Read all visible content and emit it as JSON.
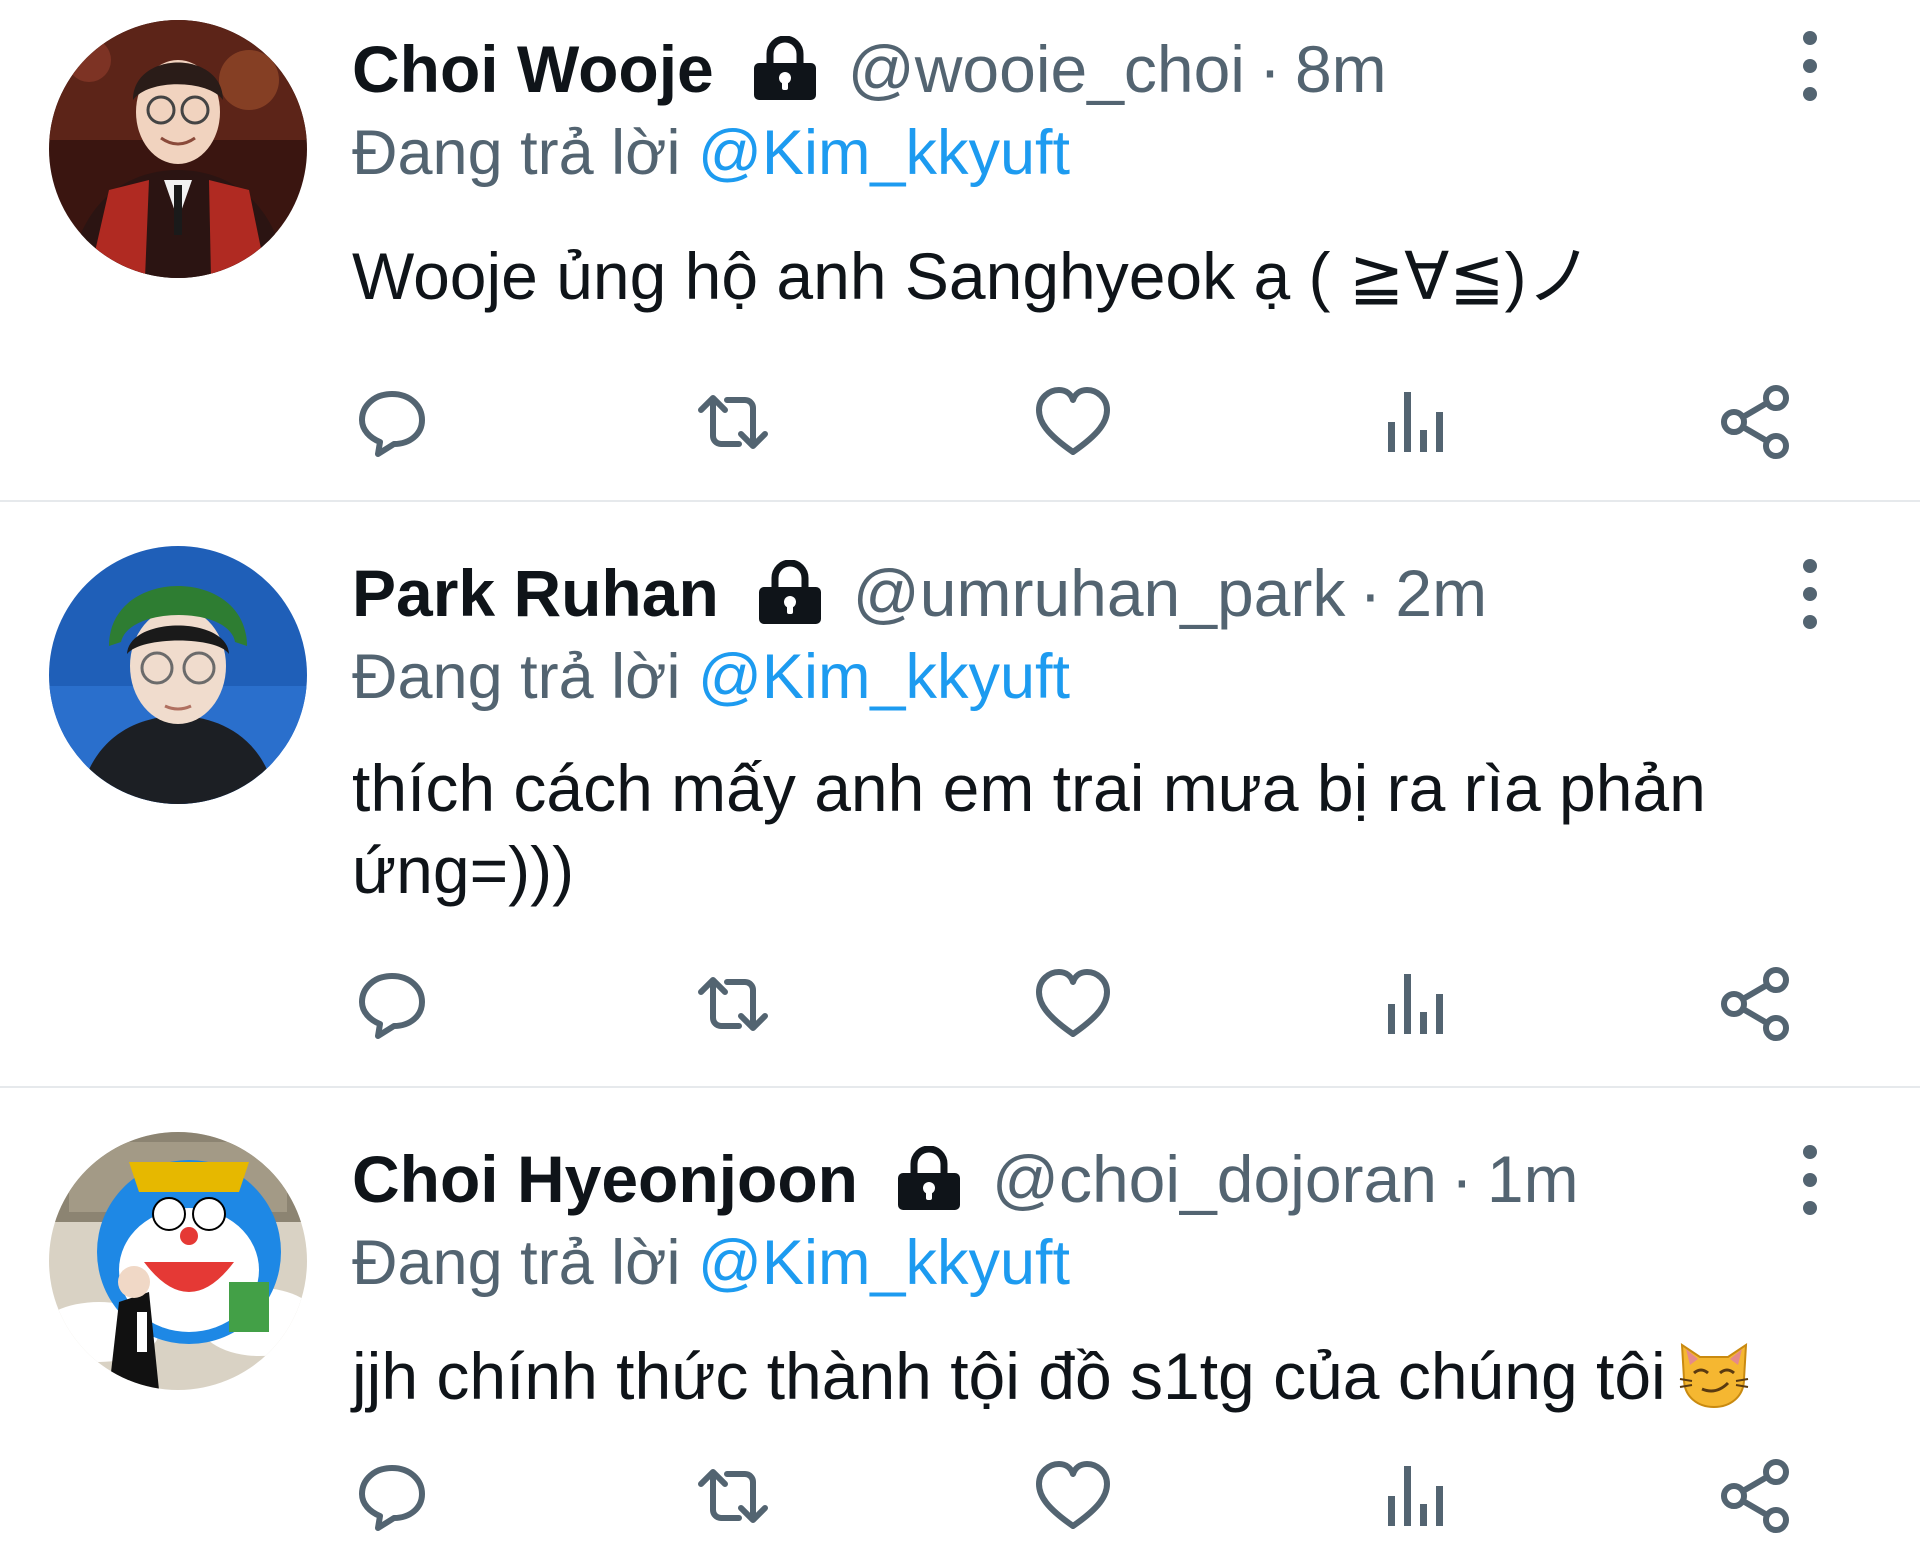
{
  "colors": {
    "text": "#0f1419",
    "secondary": "#536471",
    "accent": "#1d9bf0",
    "divider": "#e6e9ec"
  },
  "tweets": [
    {
      "name": "Choi Wooje",
      "handle": "@wooie_choi",
      "separator": "·",
      "time": "8m",
      "reply_prefix": "Đang trả lời",
      "reply_to": "@Kim_kkyuft",
      "text": "Wooje ủng hộ anh Sanghyeok ạ ( ≧∀≦)ノ",
      "protected_icon": "lock-icon"
    },
    {
      "name": "Park Ruhan",
      "handle": "@umruhan_park",
      "separator": "·",
      "time": "2m",
      "reply_prefix": "Đang trả lời",
      "reply_to": "@Kim_kkyuft",
      "text": "thích cách mấy anh em trai mưa bị ra rìa phản ứng=)))",
      "protected_icon": "lock-icon"
    },
    {
      "name": "Choi Hyeonjoon",
      "handle": "@choi_dojoran",
      "separator": "·",
      "time": "1m",
      "reply_prefix": "Đang trả lời",
      "reply_to": "@Kim_kkyuft",
      "text": "jjh chính thức thành tội đồ s1tg của chúng tôi",
      "text_emoji": "smirking-cat-emoji",
      "protected_icon": "lock-icon"
    }
  ],
  "actions": [
    "reply-icon",
    "retweet-icon",
    "like-icon",
    "views-icon",
    "share-icon"
  ]
}
